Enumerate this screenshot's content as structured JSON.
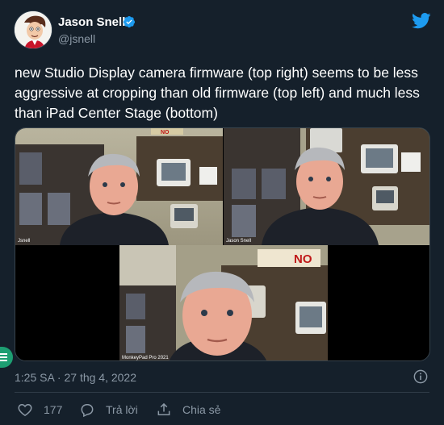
{
  "author": {
    "name": "Jason Snell",
    "handle": "@jsnell",
    "verified": true
  },
  "tweet": {
    "text": "new Studio Display camera firmware (top right) seems to be less aggressive at cropping than old firmware (top left) and much less than iPad Center Stage (bottom)",
    "timestamp": "1:25 SA · 27 thg 4, 2022"
  },
  "media": {
    "captions": {
      "top_left": "Jsnell",
      "top_right": "Jason Snell",
      "bottom": "MonkeyPad Pro 2021"
    },
    "sign_text": "NO"
  },
  "actions": {
    "like_count": "177",
    "reply_label": "Trả lời",
    "share_label": "Chia sẻ"
  },
  "icons": {
    "logo": "twitter-bird-icon",
    "verified": "verified-badge-icon",
    "info": "info-icon",
    "like": "heart-icon",
    "reply": "reply-icon",
    "share": "share-icon"
  },
  "colors": {
    "background": "#15202b",
    "accent": "#1d9bf0",
    "secondary_text": "#8b98a5"
  }
}
